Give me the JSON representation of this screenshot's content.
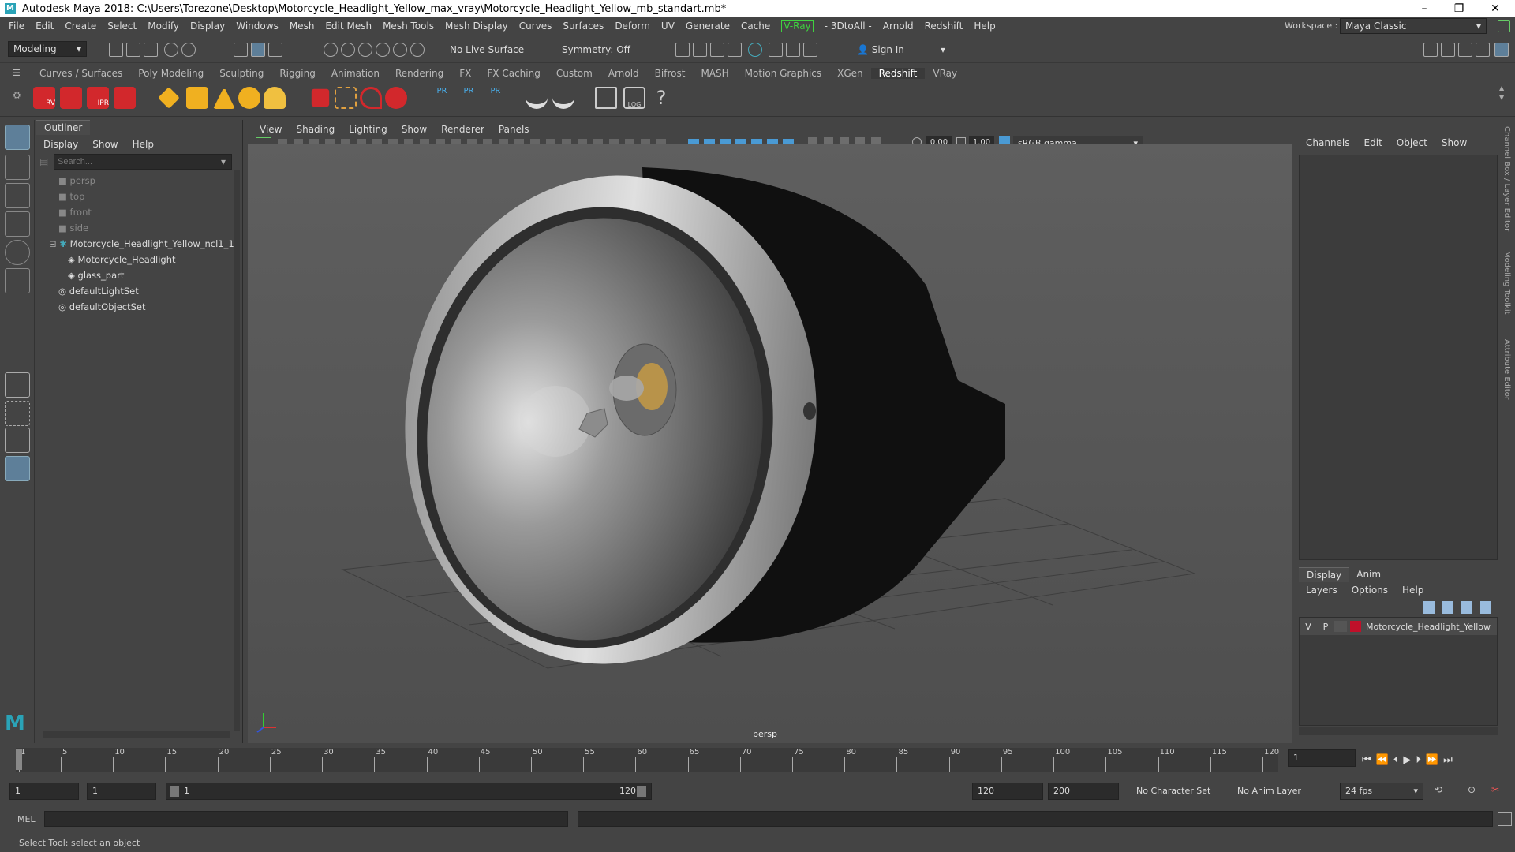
{
  "window": {
    "title": "Autodesk Maya 2018: C:\\Users\\Torezone\\Desktop\\Motorcycle_Headlight_Yellow_max_vray\\Motorcycle_Headlight_Yellow_mb_standart.mb*",
    "min": "–",
    "max": "❐",
    "close": "✕"
  },
  "menubar": {
    "items": [
      "File",
      "Edit",
      "Create",
      "Select",
      "Modify",
      "Display",
      "Windows",
      "Mesh",
      "Edit Mesh",
      "Mesh Tools",
      "Mesh Display",
      "Curves",
      "Surfaces",
      "Deform",
      "UV",
      "Generate",
      "Cache"
    ],
    "vray": "V-Ray",
    "items2": [
      "- 3DtoAll -",
      "Arnold",
      "Redshift",
      "Help"
    ],
    "workspace_label": "Workspace :",
    "workspace_value": "Maya Classic"
  },
  "toolbar": {
    "mode": "Modeling",
    "live_surface": "No Live Surface",
    "symmetry": "Symmetry: Off",
    "sign_in": "Sign In"
  },
  "shelf": {
    "tabs": [
      "Curves / Surfaces",
      "Poly Modeling",
      "Sculpting",
      "Rigging",
      "Animation",
      "Rendering",
      "FX",
      "FX Caching",
      "Custom",
      "Arnold",
      "Bifrost",
      "MASH",
      "Motion Graphics",
      "XGen",
      "Redshift",
      "VRay"
    ],
    "active": "Redshift",
    "rv": "RV",
    "ipr": "IPR",
    "pr": "PR",
    "log": "LOG"
  },
  "outliner": {
    "tab": "Outliner",
    "menu": [
      "Display",
      "Show",
      "Help"
    ],
    "search_placeholder": "Search...",
    "items": [
      "persp",
      "top",
      "front",
      "side",
      "Motorcycle_Headlight_Yellow_ncl1_1",
      "Motorcycle_Headlight",
      "glass_part",
      "defaultLightSet",
      "defaultObjectSet"
    ]
  },
  "viewport": {
    "menu": [
      "View",
      "Shading",
      "Lighting",
      "Show",
      "Renderer",
      "Panels"
    ],
    "exposure": "0.00",
    "gamma": "1.00",
    "colorspace": "sRGB gamma",
    "camera_label": "persp"
  },
  "channelbox": {
    "menu": [
      "Channels",
      "Edit",
      "Object",
      "Show"
    ]
  },
  "layer_editor": {
    "tabs": [
      "Display",
      "Anim"
    ],
    "menu": [
      "Layers",
      "Options",
      "Help"
    ],
    "layer": {
      "v": "V",
      "p": "P",
      "name": "Motorcycle_Headlight_Yellow",
      "color": "#c0102a"
    }
  },
  "side_tabs": [
    "Channel Box / Layer Editor",
    "Modeling Toolkit",
    "Attribute Editor"
  ],
  "timeline": {
    "ticks": [
      "1",
      "5",
      "10",
      "15",
      "20",
      "25",
      "30",
      "35",
      "40",
      "45",
      "50",
      "55",
      "60",
      "65",
      "70",
      "75",
      "80",
      "85",
      "90",
      "95",
      "100",
      "105",
      "110",
      "115",
      "120"
    ],
    "current_frame": "1"
  },
  "range": {
    "start": "1",
    "playback_start": "1",
    "slider_start": "1",
    "slider_end": "120",
    "playback_end": "120",
    "end": "200",
    "character_set": "No Character Set",
    "anim_layer": "No Anim Layer",
    "fps": "24 fps"
  },
  "command": {
    "label": "MEL"
  },
  "status": {
    "text": "Select Tool: select an object"
  }
}
